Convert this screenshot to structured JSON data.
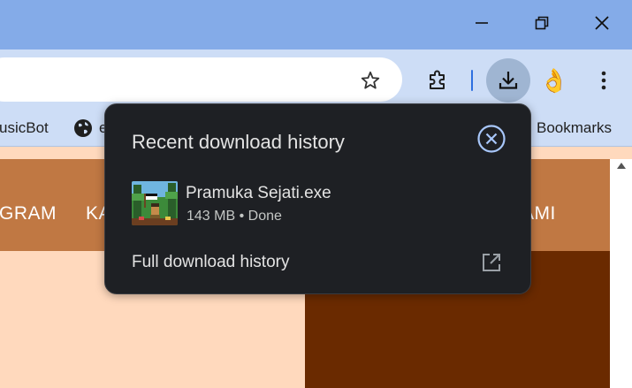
{
  "window": {
    "minimize_icon": "minimize-icon",
    "restore_icon": "restore-icon",
    "close_icon": "close-icon"
  },
  "toolbar": {
    "star_icon": "bookmark-star-icon",
    "extensions_icon": "puzzle-icon",
    "download_icon": "download-icon",
    "avatar_glyph": "👌",
    "menu_icon": "kebab-menu-icon"
  },
  "bookmarks": {
    "items": [
      {
        "label": "usicBot"
      },
      {
        "label": "e"
      }
    ],
    "all_bookmarks_label": "Bookmarks"
  },
  "page": {
    "nav": [
      "GRAM",
      "KA",
      "AMI"
    ],
    "colors": {
      "nav": "#c07843",
      "left": "#ffd9bd",
      "right": "#6a2a00"
    }
  },
  "download_popup": {
    "title": "Recent download history",
    "close_icon": "close-circle-icon",
    "items": [
      {
        "file_name": "Pramuka Sejati.exe",
        "status": "143 MB • Done"
      }
    ],
    "full_history_label": "Full download history",
    "open_icon": "open-in-new-icon"
  }
}
